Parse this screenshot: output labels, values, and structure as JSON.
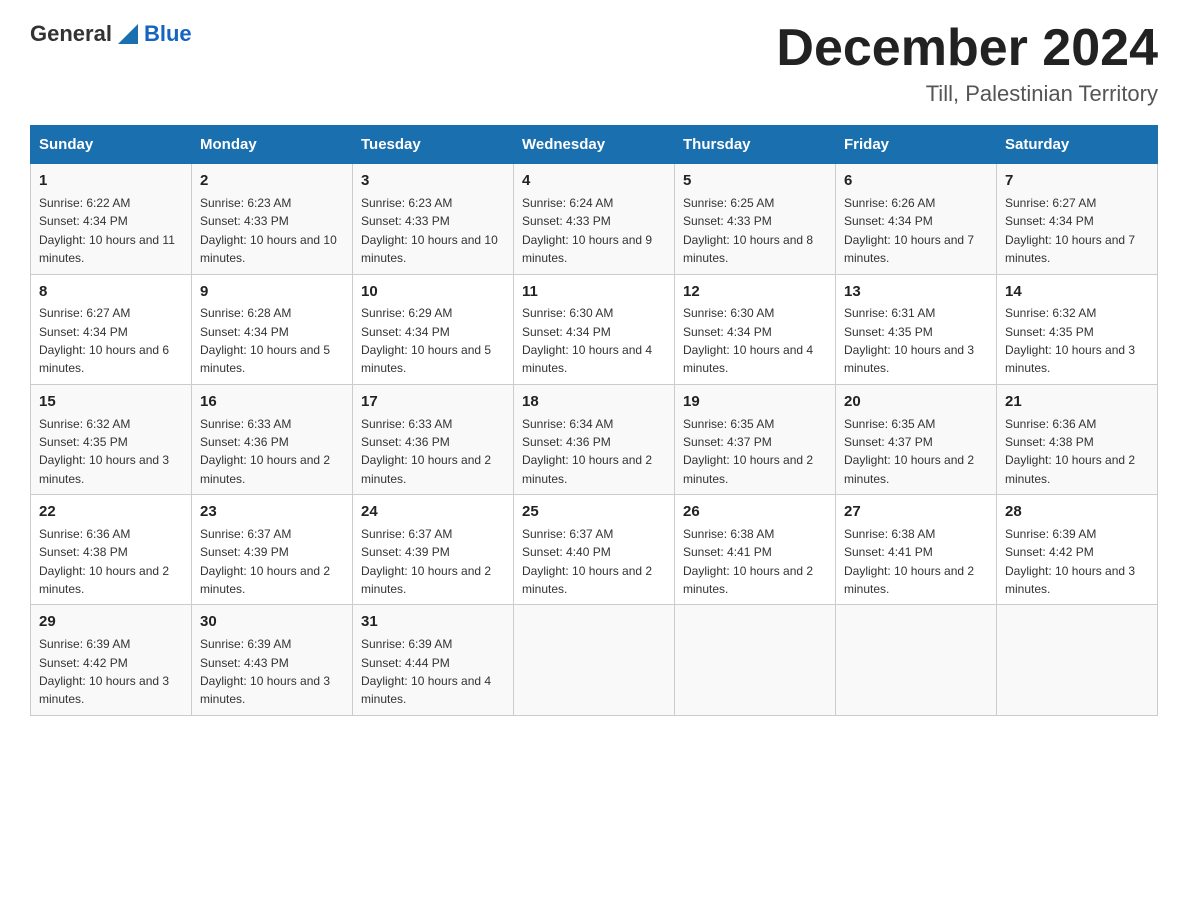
{
  "header": {
    "logo_general": "General",
    "logo_blue": "Blue",
    "title": "December 2024",
    "subtitle": "Till, Palestinian Territory"
  },
  "days_of_week": [
    "Sunday",
    "Monday",
    "Tuesday",
    "Wednesday",
    "Thursday",
    "Friday",
    "Saturday"
  ],
  "weeks": [
    [
      {
        "day": 1,
        "sunrise": "6:22 AM",
        "sunset": "4:34 PM",
        "daylight": "10 hours and 11 minutes."
      },
      {
        "day": 2,
        "sunrise": "6:23 AM",
        "sunset": "4:33 PM",
        "daylight": "10 hours and 10 minutes."
      },
      {
        "day": 3,
        "sunrise": "6:23 AM",
        "sunset": "4:33 PM",
        "daylight": "10 hours and 10 minutes."
      },
      {
        "day": 4,
        "sunrise": "6:24 AM",
        "sunset": "4:33 PM",
        "daylight": "10 hours and 9 minutes."
      },
      {
        "day": 5,
        "sunrise": "6:25 AM",
        "sunset": "4:33 PM",
        "daylight": "10 hours and 8 minutes."
      },
      {
        "day": 6,
        "sunrise": "6:26 AM",
        "sunset": "4:34 PM",
        "daylight": "10 hours and 7 minutes."
      },
      {
        "day": 7,
        "sunrise": "6:27 AM",
        "sunset": "4:34 PM",
        "daylight": "10 hours and 7 minutes."
      }
    ],
    [
      {
        "day": 8,
        "sunrise": "6:27 AM",
        "sunset": "4:34 PM",
        "daylight": "10 hours and 6 minutes."
      },
      {
        "day": 9,
        "sunrise": "6:28 AM",
        "sunset": "4:34 PM",
        "daylight": "10 hours and 5 minutes."
      },
      {
        "day": 10,
        "sunrise": "6:29 AM",
        "sunset": "4:34 PM",
        "daylight": "10 hours and 5 minutes."
      },
      {
        "day": 11,
        "sunrise": "6:30 AM",
        "sunset": "4:34 PM",
        "daylight": "10 hours and 4 minutes."
      },
      {
        "day": 12,
        "sunrise": "6:30 AM",
        "sunset": "4:34 PM",
        "daylight": "10 hours and 4 minutes."
      },
      {
        "day": 13,
        "sunrise": "6:31 AM",
        "sunset": "4:35 PM",
        "daylight": "10 hours and 3 minutes."
      },
      {
        "day": 14,
        "sunrise": "6:32 AM",
        "sunset": "4:35 PM",
        "daylight": "10 hours and 3 minutes."
      }
    ],
    [
      {
        "day": 15,
        "sunrise": "6:32 AM",
        "sunset": "4:35 PM",
        "daylight": "10 hours and 3 minutes."
      },
      {
        "day": 16,
        "sunrise": "6:33 AM",
        "sunset": "4:36 PM",
        "daylight": "10 hours and 2 minutes."
      },
      {
        "day": 17,
        "sunrise": "6:33 AM",
        "sunset": "4:36 PM",
        "daylight": "10 hours and 2 minutes."
      },
      {
        "day": 18,
        "sunrise": "6:34 AM",
        "sunset": "4:36 PM",
        "daylight": "10 hours and 2 minutes."
      },
      {
        "day": 19,
        "sunrise": "6:35 AM",
        "sunset": "4:37 PM",
        "daylight": "10 hours and 2 minutes."
      },
      {
        "day": 20,
        "sunrise": "6:35 AM",
        "sunset": "4:37 PM",
        "daylight": "10 hours and 2 minutes."
      },
      {
        "day": 21,
        "sunrise": "6:36 AM",
        "sunset": "4:38 PM",
        "daylight": "10 hours and 2 minutes."
      }
    ],
    [
      {
        "day": 22,
        "sunrise": "6:36 AM",
        "sunset": "4:38 PM",
        "daylight": "10 hours and 2 minutes."
      },
      {
        "day": 23,
        "sunrise": "6:37 AM",
        "sunset": "4:39 PM",
        "daylight": "10 hours and 2 minutes."
      },
      {
        "day": 24,
        "sunrise": "6:37 AM",
        "sunset": "4:39 PM",
        "daylight": "10 hours and 2 minutes."
      },
      {
        "day": 25,
        "sunrise": "6:37 AM",
        "sunset": "4:40 PM",
        "daylight": "10 hours and 2 minutes."
      },
      {
        "day": 26,
        "sunrise": "6:38 AM",
        "sunset": "4:41 PM",
        "daylight": "10 hours and 2 minutes."
      },
      {
        "day": 27,
        "sunrise": "6:38 AM",
        "sunset": "4:41 PM",
        "daylight": "10 hours and 2 minutes."
      },
      {
        "day": 28,
        "sunrise": "6:39 AM",
        "sunset": "4:42 PM",
        "daylight": "10 hours and 3 minutes."
      }
    ],
    [
      {
        "day": 29,
        "sunrise": "6:39 AM",
        "sunset": "4:42 PM",
        "daylight": "10 hours and 3 minutes."
      },
      {
        "day": 30,
        "sunrise": "6:39 AM",
        "sunset": "4:43 PM",
        "daylight": "10 hours and 3 minutes."
      },
      {
        "day": 31,
        "sunrise": "6:39 AM",
        "sunset": "4:44 PM",
        "daylight": "10 hours and 4 minutes."
      },
      null,
      null,
      null,
      null
    ]
  ]
}
